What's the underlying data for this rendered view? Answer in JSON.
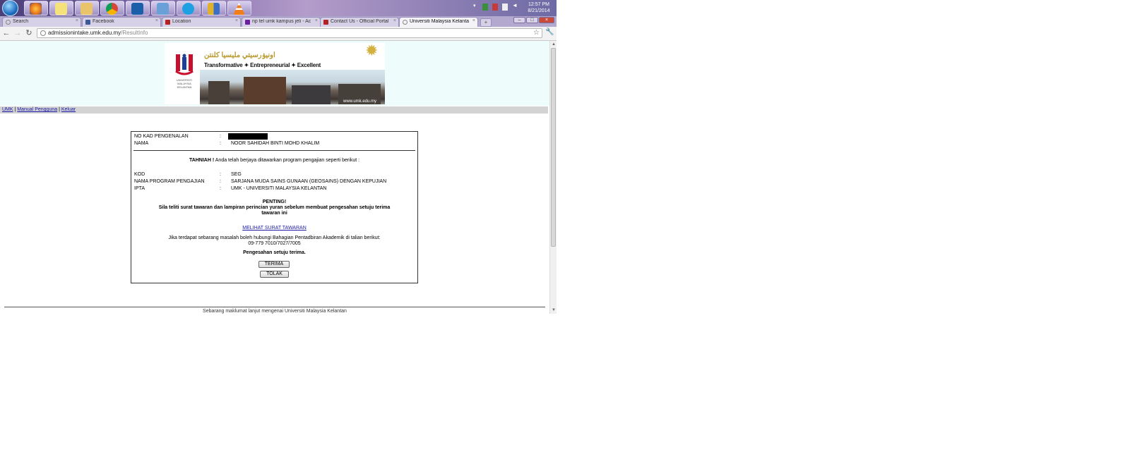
{
  "taskbar": {
    "pinned_apps": [
      {
        "icon": "firefox-icon",
        "color": "#e8731a"
      },
      {
        "icon": "sticky-notes-icon",
        "color": "#f5e27a"
      },
      {
        "icon": "file-explorer-icon",
        "color": "#e9c46a"
      },
      {
        "icon": "chrome-icon",
        "color": "#2e8b57"
      },
      {
        "icon": "celcom-icon",
        "color": "#1b5fa8"
      },
      {
        "icon": "windows-update-icon",
        "color": "#6aa0d8"
      },
      {
        "icon": "skype-icon",
        "color": "#1fa0e3"
      },
      {
        "icon": "shield-icon",
        "color": "#e0b12d"
      },
      {
        "icon": "vlc-icon",
        "color": "#f07f1a"
      }
    ],
    "clock_time": "12:57 PM",
    "clock_date": "8/21/2014"
  },
  "browser": {
    "tabs": [
      {
        "label": "Search",
        "active": false,
        "favicon_color": "#9a9a9a"
      },
      {
        "label": "Facebook",
        "active": false,
        "favicon_color": "#3b5998"
      },
      {
        "label": "Location",
        "active": false,
        "favicon_color": "#b22222"
      },
      {
        "label": "np tel umk kampus jeli - Ac",
        "active": false,
        "favicon_color": "#6b1fa0"
      },
      {
        "label": "Contact Us - Official Portal",
        "active": false,
        "favicon_color": "#b22222"
      },
      {
        "label": "Universiti Malaysia Kelantan",
        "active": true,
        "favicon_color": "#9a9a9a"
      }
    ],
    "address_host": "admissionintake.umk.edu.my",
    "address_path": "/ResultInfo"
  },
  "banner": {
    "jawi_title": "اونيۏرسيتي مليسيا كلنتن",
    "tagline": "Transformative ✦ Entrepreneurial ✦ Excellent",
    "website": "www.umk.edu.my",
    "logo_caption_1": "UNIVERSITI",
    "logo_caption_2": "MALAYSIA",
    "logo_caption_3": "KELANTAN"
  },
  "nav": {
    "umk": "UMK",
    "sep": "|",
    "manual": "Manual Pengguna",
    "logout": "Keluar"
  },
  "result": {
    "ic_label": "NO KAD PENGENALAN",
    "name_label": "NAMA",
    "colon": ":",
    "name_value": "NOOR SAHIDAH BINTI MOHD KHALIM",
    "congrats_bold": "TAHNIAH !",
    "congrats_text": " Anda telah berjaya ditawarkan program pengajian seperti berikut :",
    "code_label": "KOD",
    "code_value": "SEG",
    "program_label": "NAMA PROGRAM PENGAJIAN",
    "program_value": "SARJANA MUDA SAINS GUNAAN (GEOSAINS) DENGAN KEPUJIAN",
    "ipta_label": "IPTA",
    "ipta_value": "UMK - UNIVERSITI MALAYSIA KELANTAN",
    "important_title": "PENTING!",
    "important_line1": "Sila teliti surat tawaran dan lampiran perincian yuran sebelum membuat pengesahan setuju terima",
    "important_line2": "tawaran ini",
    "offer_link": "MELIHAT SURAT TAWARAN",
    "contact_line": "Jika terdapat sebarang masalah boleh hubungi Bahagian Pentadbiran Akademik di talian berikut:",
    "contact_phone": "09-779 7010/7027/7005",
    "confirm_label": "Pengesahan setuju terima.",
    "accept_button": "TERIMA",
    "reject_button": "TOLAK"
  },
  "footer": {
    "text": "Sebarang maklumat lanjut mengenai Universiti Malaysia Kelantan"
  }
}
